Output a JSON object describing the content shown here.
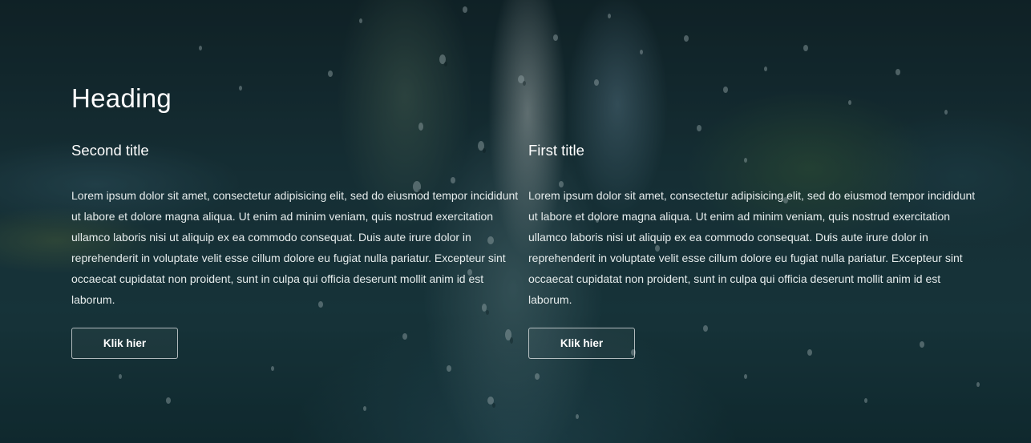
{
  "hero": {
    "heading": "Heading",
    "columns": [
      {
        "title": "Second title",
        "body": "Lorem ipsum dolor sit amet, consectetur adipisicing elit, sed do eiusmod tempor incididunt ut labore et dolore magna aliqua. Ut enim ad minim veniam, quis nostrud exercitation ullamco laboris nisi ut aliquip ex ea commodo consequat. Duis aute irure dolor in reprehenderit in voluptate velit esse cillum dolore eu fugiat nulla pariatur. Excepteur sint occaecat cupidatat non proident, sunt in culpa qui officia deserunt mollit anim id est laborum.",
        "button_label": "Klik hier"
      },
      {
        "title": "First title",
        "body": "Lorem ipsum dolor sit amet, consectetur adipisicing elit, sed do eiusmod tempor incididunt ut labore et dolore magna aliqua. Ut enim ad minim veniam, quis nostrud exercitation ullamco laboris nisi ut aliquip ex ea commodo consequat. Duis aute irure dolor in reprehenderit in voluptate velit esse cillum dolore eu fugiat nulla pariatur. Excepteur sint occaecat cupidatat non proident, sunt in culpa qui officia deserunt mollit anim id est laborum.",
        "button_label": "Klik hier"
      }
    ]
  },
  "colors": {
    "text": "#ffffff",
    "background": "#1b383f",
    "button_border": "#ffffff"
  }
}
